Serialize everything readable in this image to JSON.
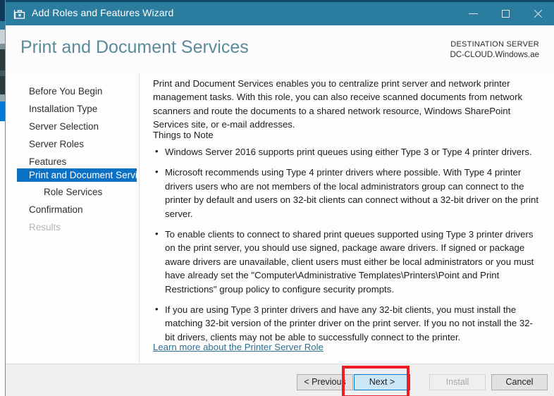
{
  "window": {
    "title": "Add Roles and Features Wizard",
    "icon": "server-manager-toolbox-icon",
    "controls": {
      "minimize": "minimize-icon",
      "maximize": "maximize-icon",
      "close": "close-icon"
    },
    "titlebar_color": "#2a7d9e"
  },
  "header": {
    "page_title": "Print and Document Services",
    "destination_label": "DESTINATION SERVER",
    "destination_value": "DC-CLOUD.Windows.ae"
  },
  "nav": {
    "items": [
      {
        "label": "Before You Begin",
        "state": "normal",
        "level": 0
      },
      {
        "label": "Installation Type",
        "state": "normal",
        "level": 0
      },
      {
        "label": "Server Selection",
        "state": "normal",
        "level": 0
      },
      {
        "label": "Server Roles",
        "state": "normal",
        "level": 0
      },
      {
        "label": "Features",
        "state": "normal",
        "level": 0
      },
      {
        "label": "Print and Document Servi...",
        "state": "selected",
        "level": 0
      },
      {
        "label": "Role Services",
        "state": "normal",
        "level": 1
      },
      {
        "label": "Confirmation",
        "state": "normal",
        "level": 0
      },
      {
        "label": "Results",
        "state": "disabled",
        "level": 0
      }
    ],
    "selected_color": "#0a71c5"
  },
  "content": {
    "intro": "Print and Document Services enables you to centralize print server and network printer management tasks. With this role, you can also receive scanned documents from network scanners and route the documents to a shared network resource, Windows SharePoint Services site, or e-mail addresses.",
    "things_to_note_heading": "Things to Note",
    "bullets": [
      "Windows Server 2016 supports print queues using either Type 3 or Type 4 printer drivers.",
      "Microsoft recommends using Type 4 printer drivers where possible. With Type 4 printer drivers users who are not members of the local administrators group can connect to the printer by default and users on 32-bit clients can connect without a 32-bit driver on the print server.",
      "To enable clients to connect to shared print queues supported using Type 3 printer drivers on the print server, you should use signed, package aware drivers. If signed or package aware drivers are unavailable, client users must either be local administrators or you must have already set the \"Computer\\Administrative Templates\\Printers\\Point and Print Restrictions\" group policy to configure security prompts.",
      "If you are using Type 3 printer drivers and have any 32-bit clients, you must install the matching 32-bit version of the printer driver on the print server. If you no not install the 32-bit drivers, clients may not be able to successfully connect to the printer."
    ],
    "learn_more_link": "Learn more about the Printer Server Role",
    "link_color": "#2b6e8f"
  },
  "footer": {
    "previous_label": "< Previous",
    "next_label": "Next >",
    "install_label": "Install",
    "cancel_label": "Cancel",
    "install_disabled": true,
    "next_highlight_color": "#cce8f7"
  },
  "annotation": {
    "type": "red-rectangle-highlight",
    "target": "next-button",
    "color": "#ee1c25"
  }
}
